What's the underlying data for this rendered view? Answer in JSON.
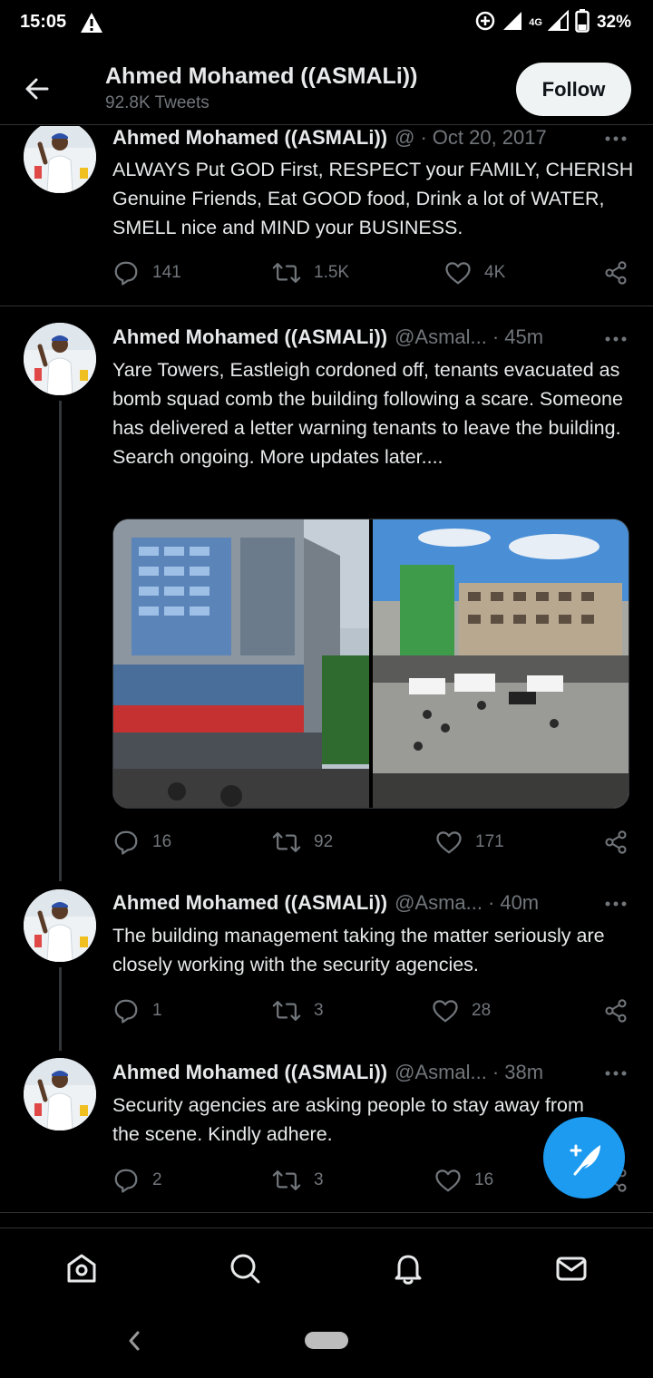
{
  "status_bar": {
    "time": "15:05",
    "network": "4G",
    "battery": "32%"
  },
  "header": {
    "name": "Ahmed Mohamed ((ASMALi))",
    "tweet_count": "92.8K Tweets",
    "follow_label": "Follow"
  },
  "tweets": [
    {
      "name": "Ahmed Mohamed ((ASMALi))",
      "handle": "@",
      "time": "Oct 20, 2017",
      "text": "ALWAYS Put GOD First, RESPECT your FAMILY, CHERISH Genuine Friends, Eat GOOD food, Drink a lot of WATER, SMELL nice and MIND your BUSINESS.",
      "replies": "141",
      "retweets": "1.5K",
      "likes": "4K"
    },
    {
      "name": "Ahmed Mohamed ((ASMALi))",
      "handle": "@Asmal...",
      "time": "45m",
      "text": "Yare Towers, Eastleigh cordoned off, tenants evacuated as bomb squad comb the building following a scare. Someone has delivered a letter warning tenants to leave the building. Search ongoing. More updates later....",
      "replies": "16",
      "retweets": "92",
      "likes": "171"
    },
    {
      "name": "Ahmed Mohamed ((ASMALi))",
      "handle": "@Asma...",
      "time": "40m",
      "text": "The building management taking the matter seriously are closely working with the security agencies.",
      "replies": "1",
      "retweets": "3",
      "likes": "28"
    },
    {
      "name": "Ahmed Mohamed ((ASMALi))",
      "handle": "@Asmal...",
      "time": "38m",
      "text": "Security agencies are asking people to stay away from the scene. Kindly adhere.",
      "replies": "2",
      "retweets": "3",
      "likes": "16"
    }
  ],
  "colors": {
    "background": "#000000",
    "accent": "#1d9bf0",
    "muted": "#71767b",
    "text": "#e7e9ea",
    "divider": "#2f3336"
  },
  "icons": {
    "back": "arrow-left-icon",
    "more": "more-dots-icon",
    "reply": "reply-icon",
    "retweet": "retweet-icon",
    "like": "heart-icon",
    "share": "share-icon",
    "compose": "compose-feather-icon",
    "nav_home": "home-icon",
    "nav_search": "search-icon",
    "nav_notifications": "bell-icon",
    "nav_messages": "mail-icon"
  }
}
